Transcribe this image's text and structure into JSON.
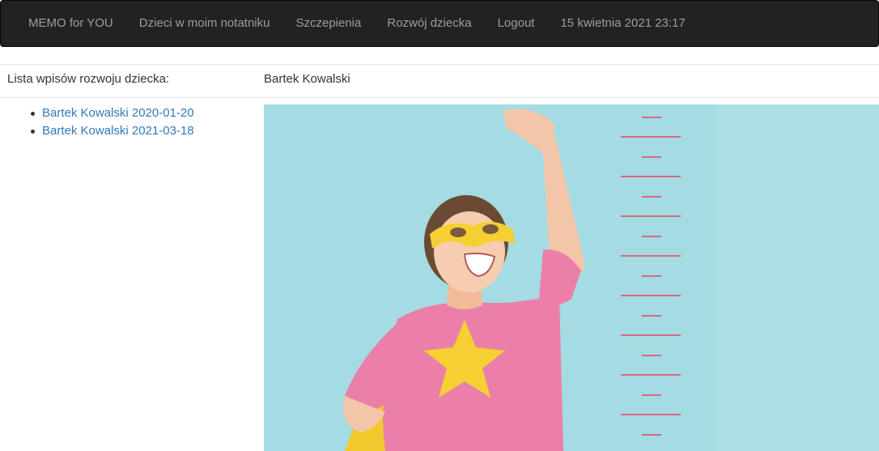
{
  "navbar": {
    "brand": "MEMO for YOU",
    "items": [
      "Dzieci w moim notatniku",
      "Szczepienia",
      "Rozwój dziecka",
      "Logout"
    ],
    "datetime": "15 kwietnia 2021 23:17"
  },
  "sidebar": {
    "heading": "Lista wpisów rozwoju dziecka:",
    "entries": [
      "Bartek Kowalski 2020-01-20",
      "Bartek Kowalski 2021-03-18"
    ]
  },
  "main": {
    "child_name": "Bartek Kowalski"
  },
  "colors": {
    "navbar_bg": "#222222",
    "nav_text": "#9d9d9d",
    "link": "#337ab7",
    "photo_bg": "#a5dbe3",
    "shirt": "#ec7fa9",
    "star": "#f4d130",
    "ruler": "#d76a86"
  }
}
